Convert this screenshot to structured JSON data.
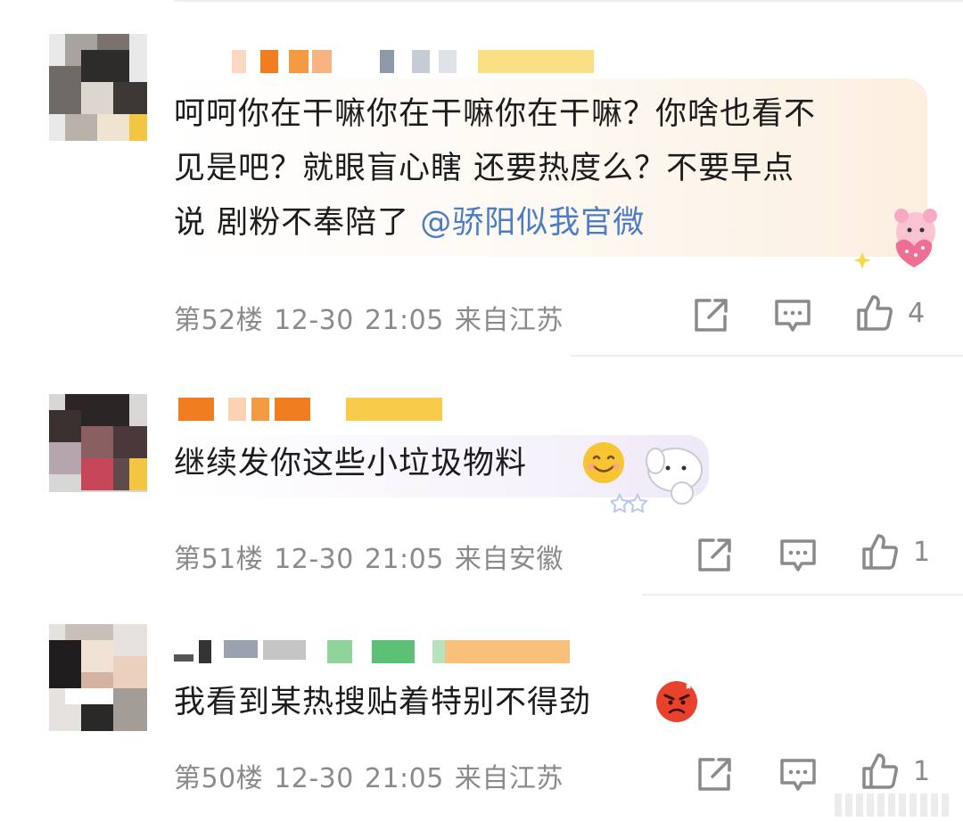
{
  "comments": [
    {
      "text": "呵呵你在干嘛你在干嘛你在干嘛？你啥也看不\n见是吧？就眼盲心瞎 还要热度么？不要早点\n说 剧粉不奉陪了 ",
      "mention": "@骄阳似我官微",
      "floor": "第52楼",
      "date": "12-30",
      "time": "21:05",
      "location": "来自江苏",
      "likes": "4"
    },
    {
      "text": "继续发你这些小垃圾物料",
      "floor": "第51楼",
      "date": "12-30",
      "time": "21:05",
      "location": "来自安徽",
      "likes": "1",
      "emoji": "smiling-emoji"
    },
    {
      "text": "我看到某热搜贴着特别不得劲",
      "floor": "第50楼",
      "date": "12-30",
      "time": "21:05",
      "location": "来自江苏",
      "likes": "1",
      "emoji": "angry-emoji"
    }
  ],
  "colors": {
    "mention": "#4a7cc9",
    "meta": "#8a8a8a",
    "bubble1": "#fdf3e6",
    "bubble2": "#f2eefa",
    "angry": "#e8412c",
    "smile": "#f7c531"
  },
  "icons": [
    "share-icon",
    "comment-icon",
    "like-icon"
  ]
}
